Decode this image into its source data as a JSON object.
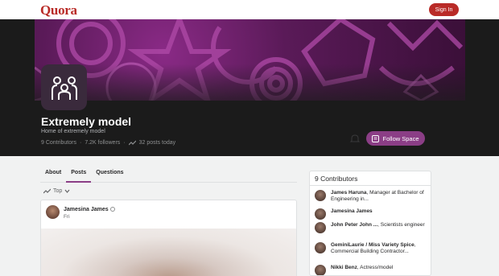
{
  "header": {
    "logo": "Quora",
    "signin_label": "Sign In"
  },
  "space": {
    "title": "Extremely model",
    "description": "Home of extremely model",
    "contributors": "9 Contributors",
    "separator": "·",
    "followers": "7.2K followers",
    "posts_today": "32 posts today",
    "follow_label": "Follow Space"
  },
  "tabs": [
    "About",
    "Posts",
    "Questions"
  ],
  "sort_label": "Top",
  "post": {
    "author": "Jamesina James",
    "time": "Fri"
  },
  "sidebar": {
    "title": "9 Contributors",
    "contributors": [
      {
        "name": "James Haruna",
        "desc": ", Manager at Bachelor of Engineering in..."
      },
      {
        "name": "Jamesina James",
        "desc": ""
      },
      {
        "name": "John Peter John ...",
        "desc": ", Scientists engineer"
      },
      {
        "name": "GeminiLaurie / Miss Variety Spice",
        "desc": ", Commercial Building Contractor..."
      },
      {
        "name": "Nikki Benz",
        "desc": ", Actress/model"
      }
    ]
  },
  "colors": {
    "brand": "#b92b27",
    "accent": "#8b3e86",
    "hero_bg": "#1b1b1b"
  }
}
